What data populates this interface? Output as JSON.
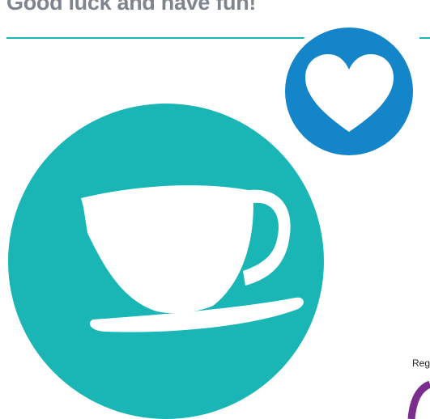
{
  "header": {
    "title": "Good luck and have fun!"
  },
  "badge": {
    "icon": "heart-icon"
  },
  "illustration": {
    "icon": "teacup-icon"
  },
  "side_label": "Reg",
  "colors": {
    "teal": "#1ab6b6",
    "blue": "#1385c8",
    "purple": "#7b2d8e",
    "heading_gray": "#7e8590"
  }
}
